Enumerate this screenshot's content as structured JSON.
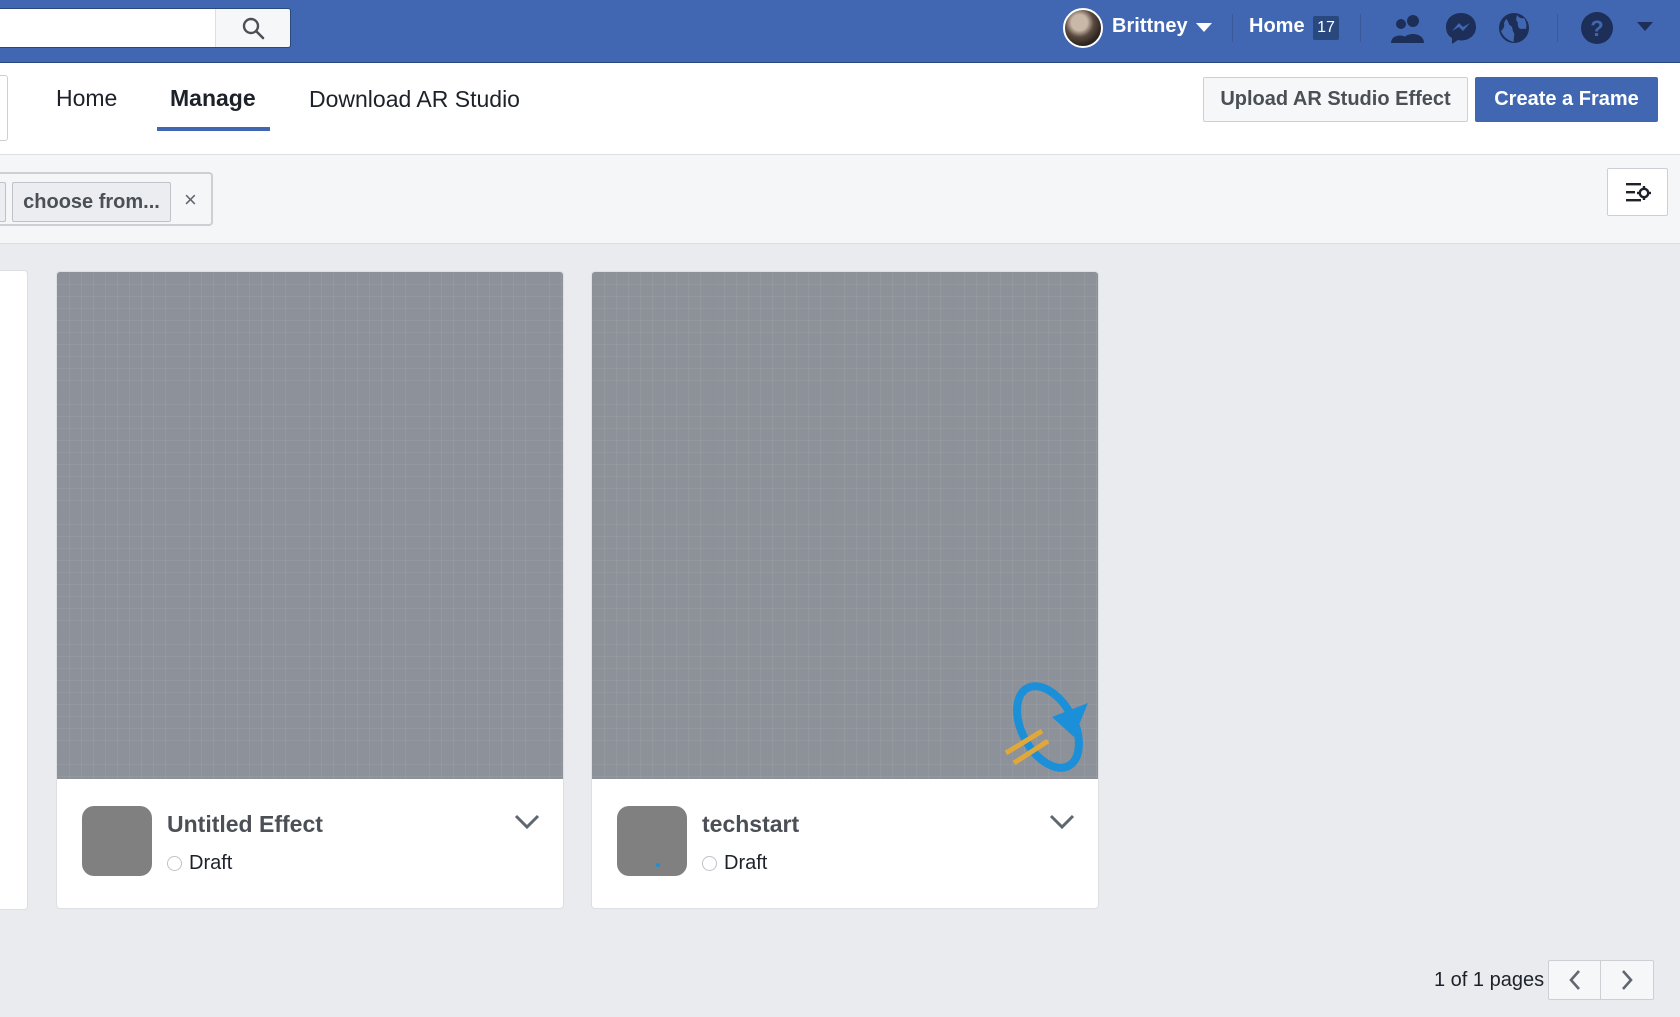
{
  "topbar": {
    "user_name": "Brittney",
    "home_label": "Home",
    "home_count": "17",
    "accent": "#4267b2"
  },
  "subnav": {
    "tabs": [
      {
        "label": "Home"
      },
      {
        "label": "Manage",
        "active": true
      },
      {
        "label": "Download AR Studio"
      }
    ],
    "upload_label": "Upload AR Studio Effect",
    "create_label": "Create a Frame"
  },
  "filter": {
    "chip_label": "choose from...",
    "clear_icon": "×"
  },
  "cards": [
    {
      "name": "Untitled Effect",
      "status": "Draft"
    },
    {
      "name": "techstart",
      "status": "Draft"
    }
  ],
  "pagination": {
    "info": "1 of 1 pages"
  }
}
